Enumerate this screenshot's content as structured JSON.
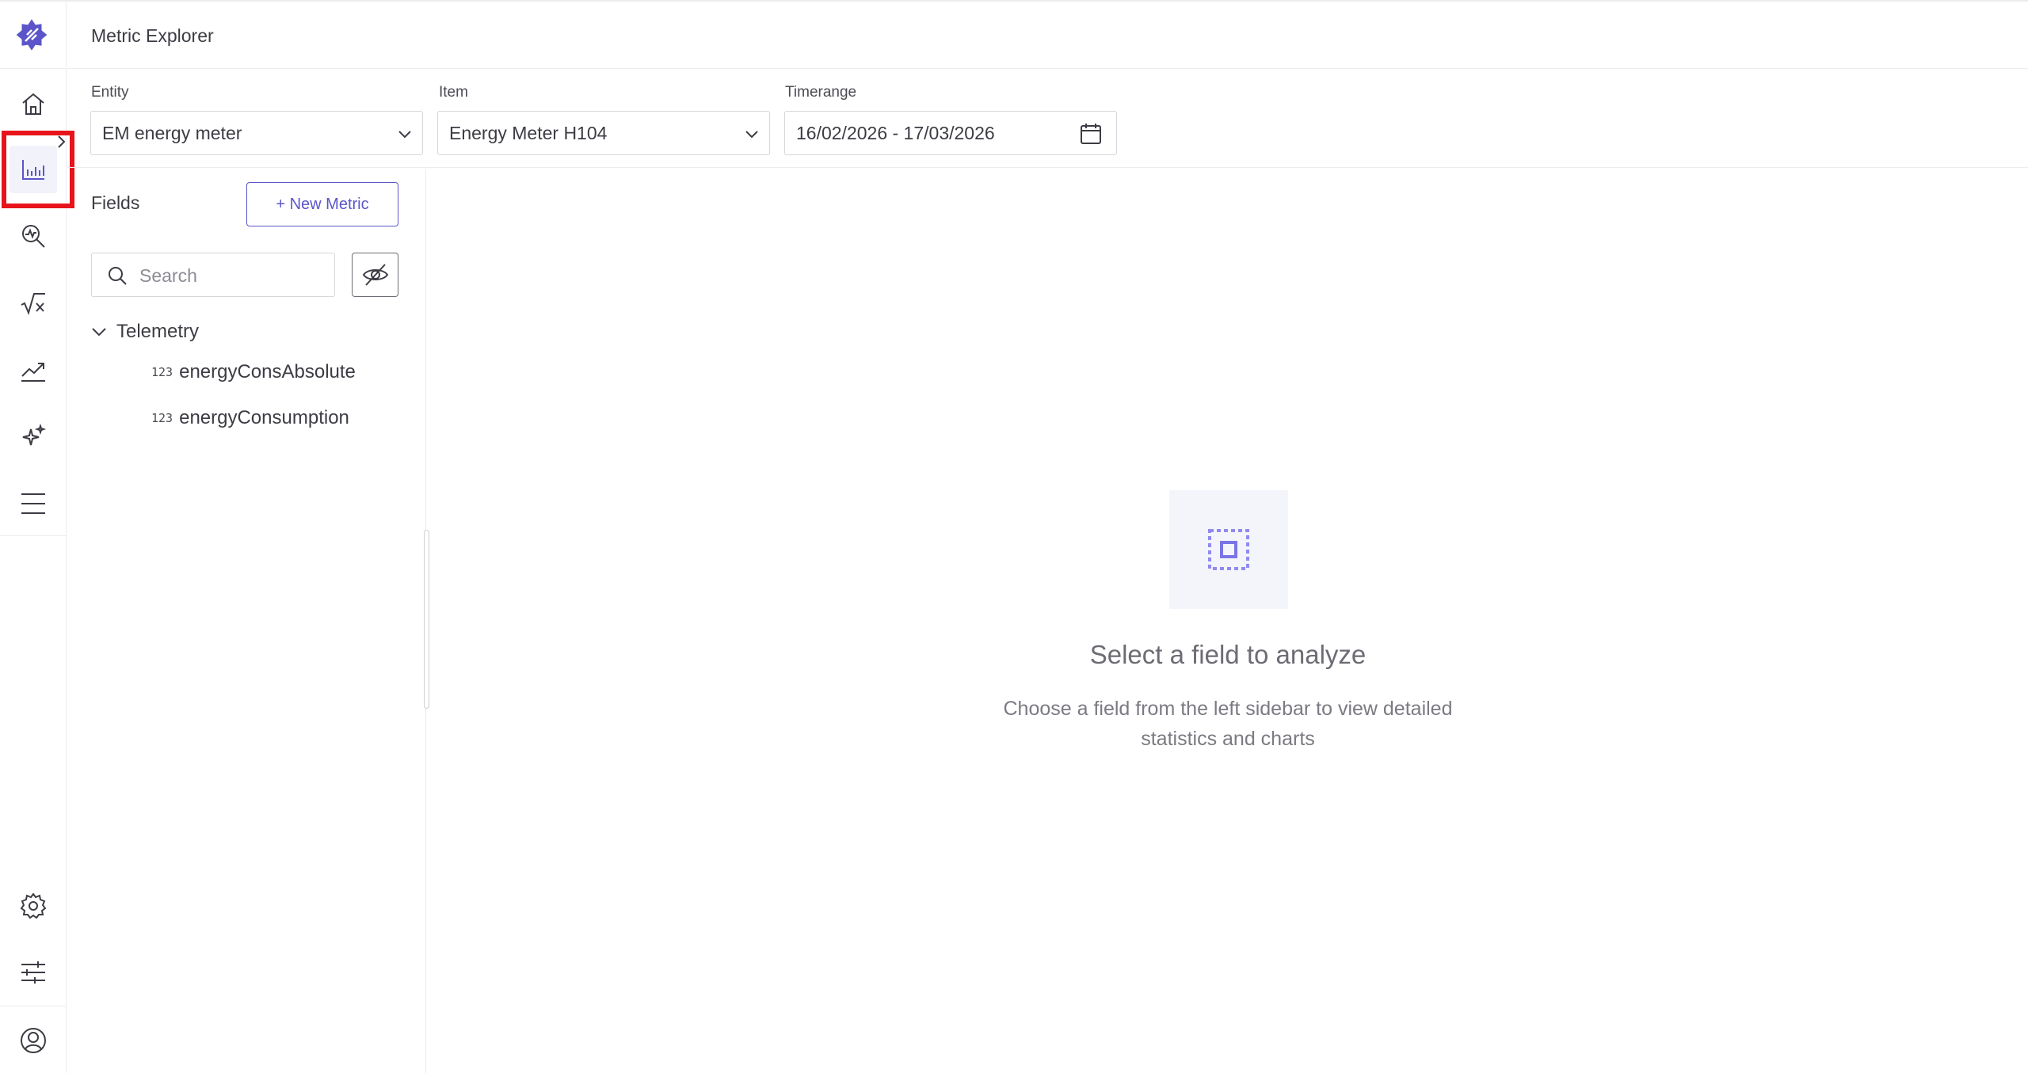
{
  "header": {
    "title": "Metric Explorer"
  },
  "nav": {
    "items": [
      "home-icon",
      "bar-chart-icon",
      "analyze-search-icon",
      "formula-icon",
      "trend-chart-icon",
      "sparkle-icon",
      "menu-icon"
    ],
    "bottom_items": [
      "settings-icon",
      "sliders-icon",
      "user-icon"
    ],
    "active": "bar-chart-icon",
    "accent_color": "#5b55c9",
    "highlight_color": "#e8141b"
  },
  "filters": {
    "entity": {
      "label": "Entity",
      "value": "EM energy meter"
    },
    "item": {
      "label": "Item",
      "value": "Energy Meter H104"
    },
    "timerange": {
      "label": "Timerange",
      "value": "16/02/2026 - 17/03/2026"
    }
  },
  "fields": {
    "title": "Fields",
    "new_metric_label": "+ New Metric",
    "search_placeholder": "Search",
    "groups": [
      {
        "name": "Telemetry",
        "items": [
          {
            "type": "123",
            "name": "energyConsAbsolute"
          },
          {
            "type": "123",
            "name": "energyConsumption"
          }
        ]
      }
    ]
  },
  "empty_state": {
    "title": "Select a field to analyze",
    "description": "Choose a field from the left sidebar to view detailed statistics and charts"
  }
}
